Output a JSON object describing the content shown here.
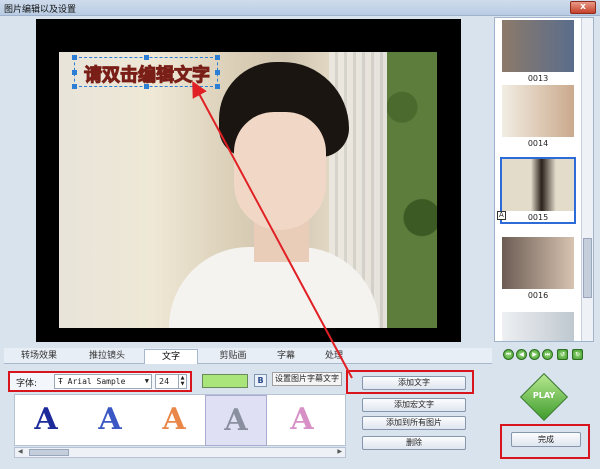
{
  "window": {
    "title": "图片编辑以及设置",
    "close_label": "x"
  },
  "preview": {
    "caption": "请双击编辑文字"
  },
  "thumbnails": [
    {
      "label": "0013",
      "colors": [
        "#8c7a6a",
        "#5a6d8c"
      ]
    },
    {
      "label": "0014",
      "colors": [
        "#f2ede3",
        "#caa98c"
      ]
    },
    {
      "label": "0015",
      "colors": [
        "#e4dccb",
        "#2a211c"
      ],
      "selected": true,
      "badge": "A"
    },
    {
      "label": "0016",
      "colors": [
        "#6b5c53",
        "#d8c3b1"
      ]
    },
    {
      "label": "",
      "colors": [
        "#eef0f2",
        "#bfc8d0"
      ]
    }
  ],
  "tabs": [
    "转场效果",
    "推拉镜头",
    "文字",
    "剪贴画",
    "字幕",
    "处理"
  ],
  "active_tab": "文字",
  "font": {
    "label": "字体:",
    "family_value": "Ŧ Arial  Sample",
    "size_value": "24"
  },
  "text_color": "#a9e57b",
  "bold_label": "B",
  "tooltip": "设置图片字幕文字",
  "styles": [
    {
      "glyph": "A",
      "color": "#1d2a9a"
    },
    {
      "glyph": "A",
      "color": "#3a57c4"
    },
    {
      "glyph": "A",
      "color": "#e9874a"
    },
    {
      "glyph": "A",
      "color": "#8a8fa0"
    },
    {
      "glyph": "A",
      "color": "#d690c6"
    }
  ],
  "actions": {
    "add_text": "添加文字",
    "add_macro_text": "添加宏文字",
    "add_to_all": "添加到所有图片",
    "delete": "删除"
  },
  "play_label": "PLAY",
  "finish_label": "完成"
}
